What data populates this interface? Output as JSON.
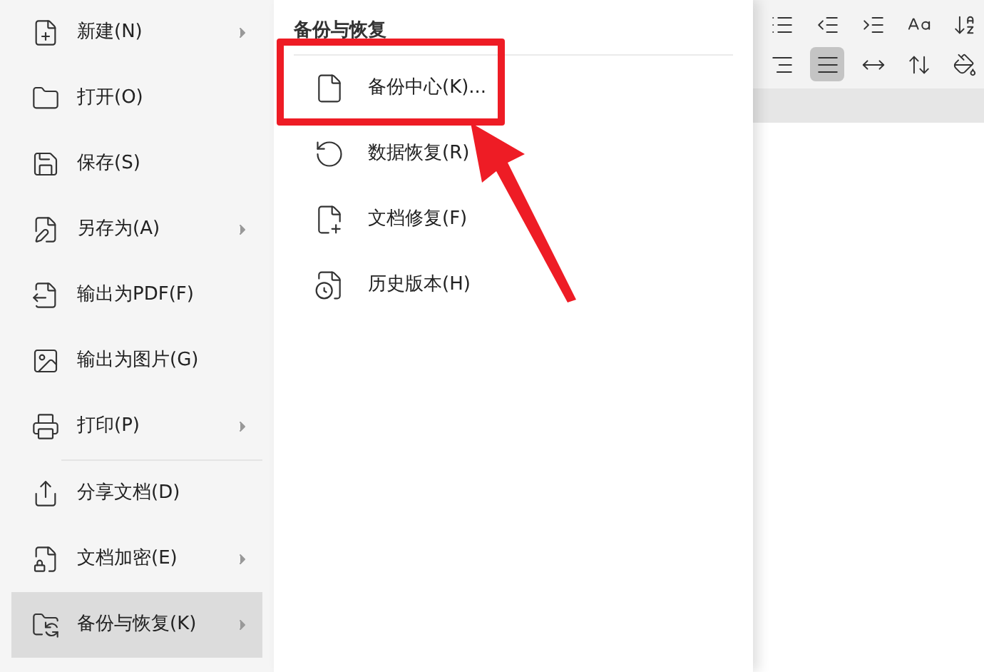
{
  "file_menu": {
    "groups": [
      [
        {
          "label": "新建(N)",
          "has_submenu": true,
          "selected": false
        },
        {
          "label": "打开(O)",
          "has_submenu": false,
          "selected": false
        },
        {
          "label": "保存(S)",
          "has_submenu": false,
          "selected": false
        },
        {
          "label": "另存为(A)",
          "has_submenu": true,
          "selected": false
        },
        {
          "label": "输出为PDF(F)",
          "has_submenu": false,
          "selected": false
        },
        {
          "label": "输出为图片(G)",
          "has_submenu": false,
          "selected": false
        },
        {
          "label": "打印(P)",
          "has_submenu": true,
          "selected": false
        }
      ],
      [
        {
          "label": "分享文档(D)",
          "has_submenu": false,
          "selected": false
        },
        {
          "label": "文档加密(E)",
          "has_submenu": true,
          "selected": false
        },
        {
          "label": "备份与恢复(K)",
          "has_submenu": true,
          "selected": true
        }
      ]
    ]
  },
  "submenu": {
    "title": "备份与恢复",
    "items": [
      {
        "label": "备份中心(K)..."
      },
      {
        "label": "数据恢复(R)"
      },
      {
        "label": "文档修复(F)"
      },
      {
        "label": "历史版本(H)"
      }
    ]
  },
  "toolbar": {
    "rows": [
      [
        {
          "kind": "list",
          "selected": false
        },
        {
          "kind": "outdent",
          "selected": false
        },
        {
          "kind": "indent",
          "selected": false
        },
        {
          "kind": "spacing",
          "selected": false
        },
        {
          "kind": "sort",
          "selected": false
        }
      ],
      [
        {
          "kind": "align-right",
          "selected": false
        },
        {
          "kind": "justify",
          "selected": true
        },
        {
          "kind": "distribute",
          "selected": false
        },
        {
          "kind": "line-spacing",
          "selected": false
        },
        {
          "kind": "shading",
          "selected": false
        }
      ]
    ]
  }
}
